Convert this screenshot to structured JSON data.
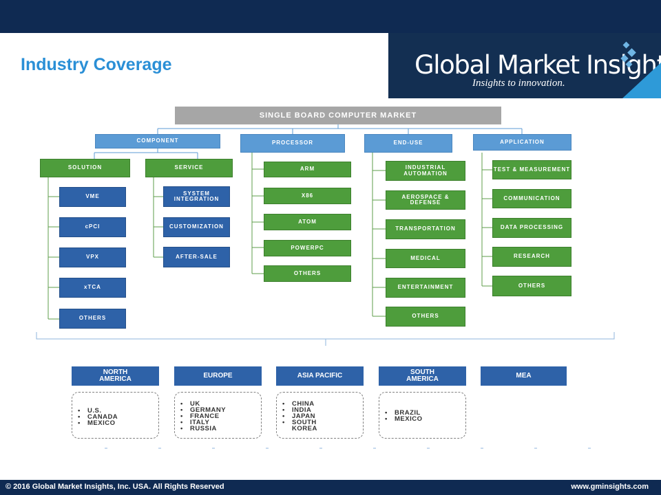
{
  "title": "Industry Coverage",
  "logo": {
    "name": "Global Market Insights",
    "tagline": "Insights to innovation."
  },
  "root": "SINGLE BOARD COMPUTER MARKET",
  "component": {
    "label": "COMPONENT",
    "solution": {
      "label": "SOLUTION",
      "items": [
        "VME",
        "cPCI",
        "VPX",
        "xTCA",
        "OTHERS"
      ]
    },
    "service": {
      "label": "SERVICE",
      "items": [
        "SYSTEM INTEGRATION",
        "CUSTOMIZATION",
        "AFTER-SALE"
      ]
    }
  },
  "processor": {
    "label": "PROCESSOR",
    "items": [
      "ARM",
      "X86",
      "ATOM",
      "POWERPC",
      "OTHERS"
    ]
  },
  "enduse": {
    "label": "END-USE",
    "items": [
      "INDUSTRIAL AUTOMATION",
      "AEROSPACE & DEFENSE",
      "TRANSPORTATION",
      "MEDICAL",
      "ENTERTAINMENT",
      "OTHERS"
    ]
  },
  "application": {
    "label": "APPLICATION",
    "items": [
      "TEST & MEASUREMENT",
      "COMMUNICATION",
      "DATA PROCESSING",
      "RESEARCH",
      "OTHERS"
    ]
  },
  "regions": [
    {
      "name": "NORTH AMERICA",
      "countries": [
        "U.S.",
        "CANADA",
        "MEXICO"
      ]
    },
    {
      "name": "EUROPE",
      "countries": [
        "UK",
        "GERMANY",
        "FRANCE",
        "ITALY",
        "RUSSIA"
      ]
    },
    {
      "name": "ASIA PACIFIC",
      "countries": [
        "CHINA",
        "INDIA",
        "JAPAN",
        "SOUTH KOREA"
      ]
    },
    {
      "name": "SOUTH AMERICA",
      "countries": [
        "BRAZIL",
        "MEXICO"
      ]
    },
    {
      "name": "MEA",
      "countries": []
    }
  ],
  "footer": {
    "copyright": "© 2016 Global Market Insights, Inc. USA. All Rights Reserved",
    "website": "www.gminsights.com"
  },
  "colors": {
    "header": "#0f2a52",
    "title": "#2a8fd6",
    "green": "#4e9d3c",
    "light_blue": "#5b9bd5",
    "dark_blue": "#2e62a8",
    "root_gray": "#a6a6a6"
  }
}
